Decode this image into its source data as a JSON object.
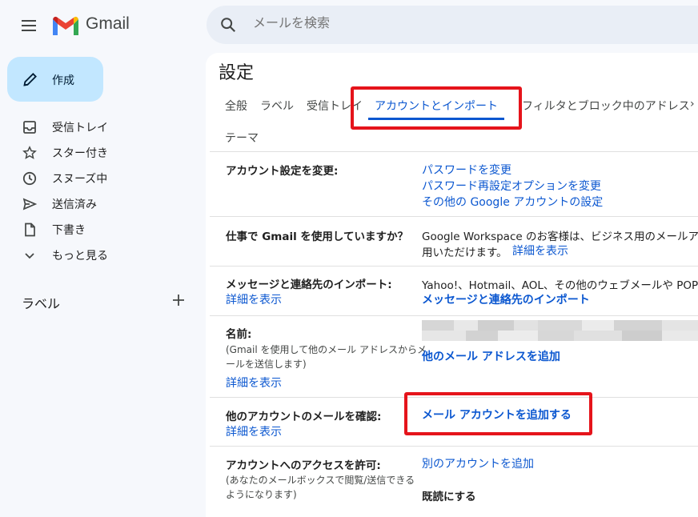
{
  "header": {
    "app_name": "Gmail",
    "search_placeholder": "メールを検索"
  },
  "compose": {
    "label": "作成"
  },
  "nav": [
    {
      "label": "受信トレイ",
      "icon": "inbox-icon"
    },
    {
      "label": "スター付き",
      "icon": "star-icon"
    },
    {
      "label": "スヌーズ中",
      "icon": "clock-icon"
    },
    {
      "label": "送信済み",
      "icon": "send-icon"
    },
    {
      "label": "下書き",
      "icon": "draft-icon"
    },
    {
      "label": "もっと見る",
      "icon": "chevron-down-icon"
    }
  ],
  "labels": {
    "title": "ラベル"
  },
  "settings": {
    "title": "設定",
    "tabs": [
      "全般",
      "ラベル",
      "受信トレイ",
      "アカウントとインポート",
      "フィルタとブロック中のアドレス",
      "›",
      "テーマ"
    ],
    "active_tab": "アカウントとインポート",
    "rows": {
      "account": {
        "label": "アカウント設定を変更:",
        "links": [
          "パスワードを変更",
          "パスワード再設定オプションを変更",
          "その他の Google アカウントの設定"
        ]
      },
      "workspace": {
        "label": "仕事で Gmail を使用していますか？",
        "text_line1": "Google Workspace のお客様は、ビジネス用のメールア",
        "text_line2": "用いただけます。",
        "link": "詳細を表示"
      },
      "import": {
        "label": "メッセージと連絡先のインポート:",
        "details": "詳細を表示",
        "text": "Yahoo!、Hotmail、AOL、その他のウェブメールや POP",
        "link": "メッセージと連絡先のインポート"
      },
      "name": {
        "label": "名前:",
        "sub1": "(Gmail を使用して他のメール アドレスからメ",
        "sub2": "ールを送信します)",
        "details": "詳細を表示",
        "link": "他のメール アドレスを追加"
      },
      "check": {
        "label": "他のアカウントのメールを確認:",
        "details": "詳細を表示",
        "link": "メール アカウントを追加する"
      },
      "access": {
        "label": "アカウントへのアクセスを許可:",
        "sub1": "(あなたのメールボックスで閲覧/送信できる",
        "sub2": "ようになります)",
        "link": "別のアカウントを追加",
        "mark_read": "既読にする"
      }
    }
  },
  "colors": {
    "accent": "#0b57d0",
    "compose_bg": "#c2e7ff",
    "highlight": "#e5141b"
  }
}
